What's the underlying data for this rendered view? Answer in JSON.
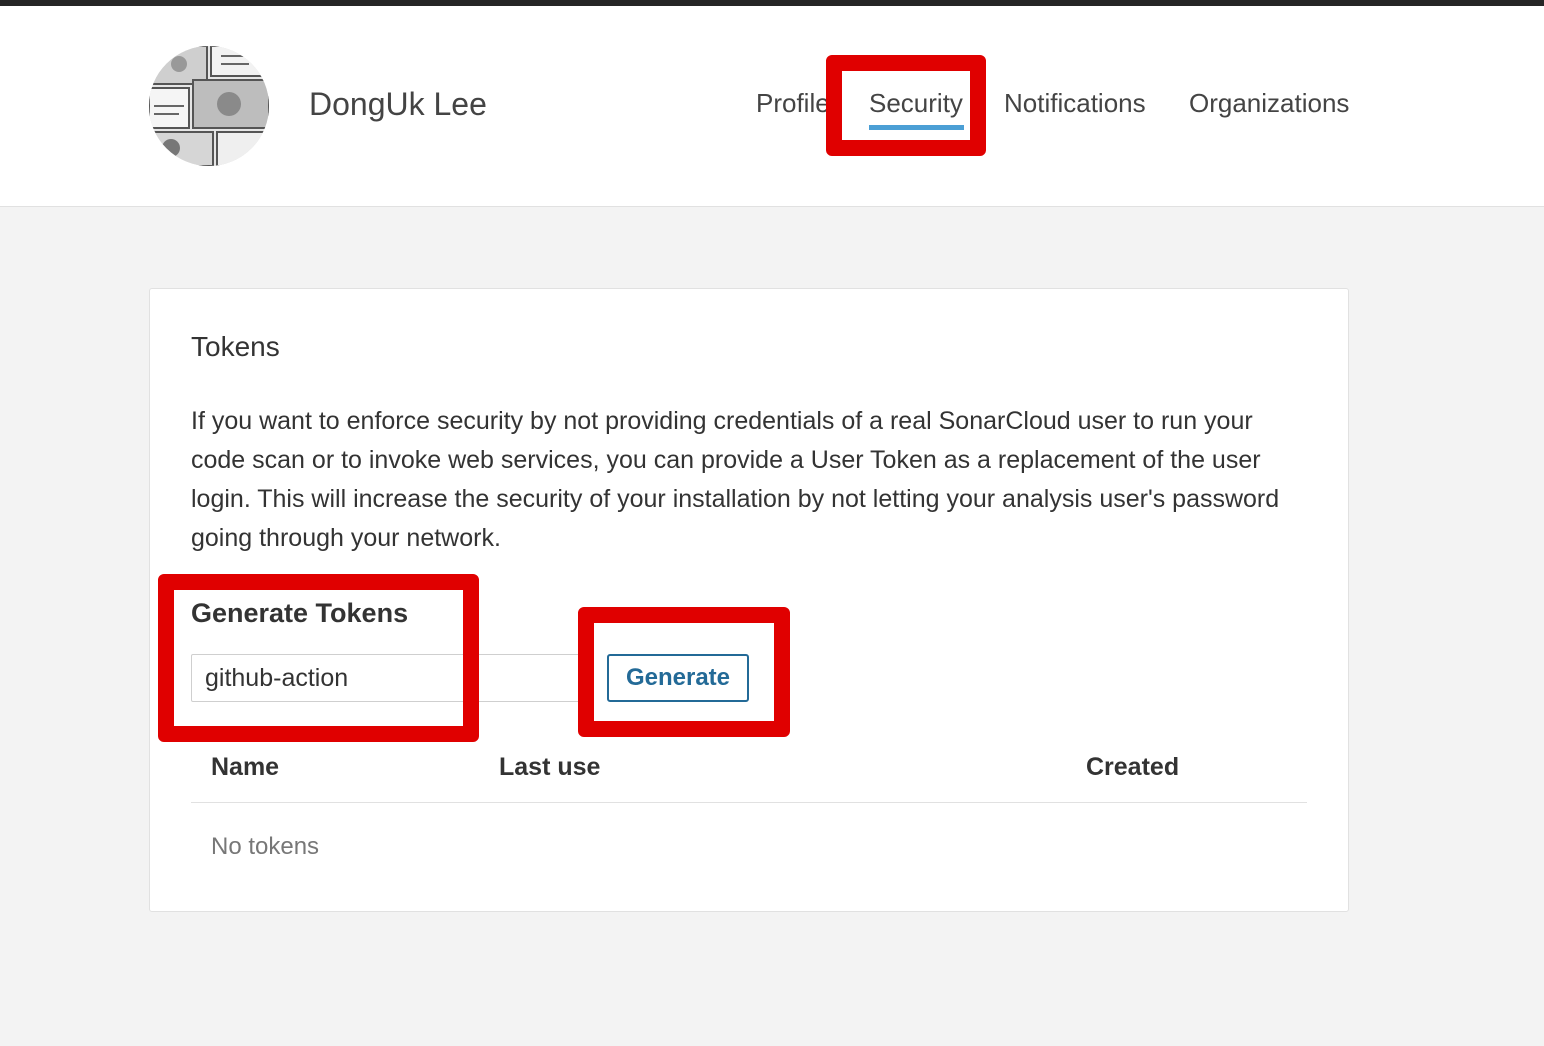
{
  "user": {
    "name": "DongUk Lee"
  },
  "nav": {
    "items": [
      {
        "label": "Profile"
      },
      {
        "label": "Security"
      },
      {
        "label": "Notifications"
      },
      {
        "label": "Organizations"
      }
    ],
    "active": "Security"
  },
  "tokens": {
    "title": "Tokens",
    "description": "If you want to enforce security by not providing credentials of a real SonarCloud user to run your code scan or to invoke web services, you can provide a User Token as a replacement of the user login. This will increase the security of your installation by not letting your analysis user's password going through your network.",
    "generate_title": "Generate Tokens",
    "input_value": "github-action",
    "generate_button": "Generate",
    "columns": [
      "Name",
      "Last use",
      "Created"
    ],
    "empty_message": "No tokens"
  },
  "colors": {
    "accent": "#4b9fd5",
    "button": "#236a97",
    "highlight": "#e00000"
  },
  "icons": {
    "avatar": "manga-avatar-image"
  }
}
